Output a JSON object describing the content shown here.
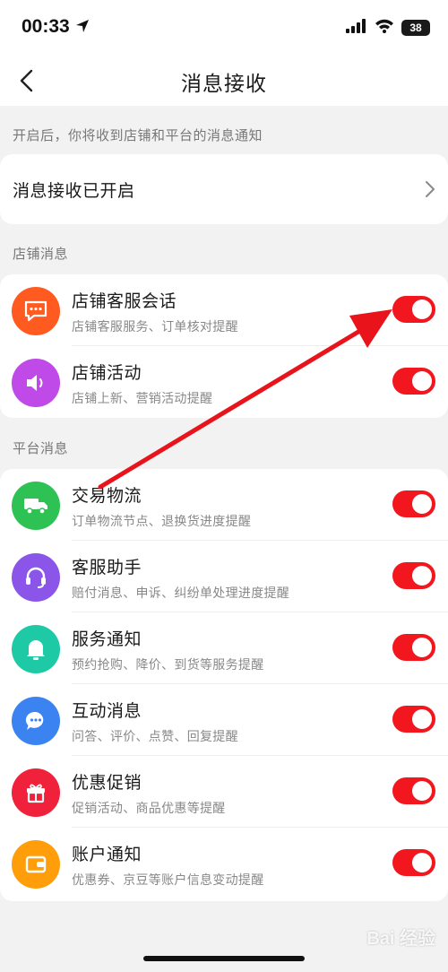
{
  "status_bar": {
    "time": "00:33",
    "battery": "38"
  },
  "nav": {
    "title": "消息接收"
  },
  "hint": "开启后，你将收到店铺和平台的消息通知",
  "master": {
    "label": "消息接收已开启"
  },
  "sections": [
    {
      "title": "店铺消息",
      "items": [
        {
          "title": "店铺客服会话",
          "subtitle": "店铺客服服务、订单核对提醒",
          "icon": "chat-bubble-icon",
          "color": "#ff5a1f",
          "enabled": true
        },
        {
          "title": "店铺活动",
          "subtitle": "店铺上新、营销活动提醒",
          "icon": "speaker-icon",
          "color": "#c04ae8",
          "enabled": true
        }
      ]
    },
    {
      "title": "平台消息",
      "items": [
        {
          "title": "交易物流",
          "subtitle": "订单物流节点、退换货进度提醒",
          "icon": "truck-icon",
          "color": "#2ec254",
          "enabled": true
        },
        {
          "title": "客服助手",
          "subtitle": "赔付消息、申诉、纠纷单处理进度提醒",
          "icon": "headset-icon",
          "color": "#8a55e8",
          "enabled": true
        },
        {
          "title": "服务通知",
          "subtitle": "预约抢购、降价、到货等服务提醒",
          "icon": "bell-icon",
          "color": "#1ec9a6",
          "enabled": true
        },
        {
          "title": "互动消息",
          "subtitle": "问答、评价、点赞、回复提醒",
          "icon": "comment-icon",
          "color": "#3b83f0",
          "enabled": true
        },
        {
          "title": "优惠促销",
          "subtitle": "促销活动、商品优惠等提醒",
          "icon": "gift-icon",
          "color": "#f0213a",
          "enabled": true
        },
        {
          "title": "账户通知",
          "subtitle": "优惠券、京豆等账户信息变动提醒",
          "icon": "wallet-icon",
          "color": "#ff9d0a",
          "enabled": true
        }
      ]
    }
  ],
  "watermark": "Bai 经验",
  "colors": {
    "toggle_on": "#f2161e",
    "annotation_arrow": "#e8131b"
  }
}
